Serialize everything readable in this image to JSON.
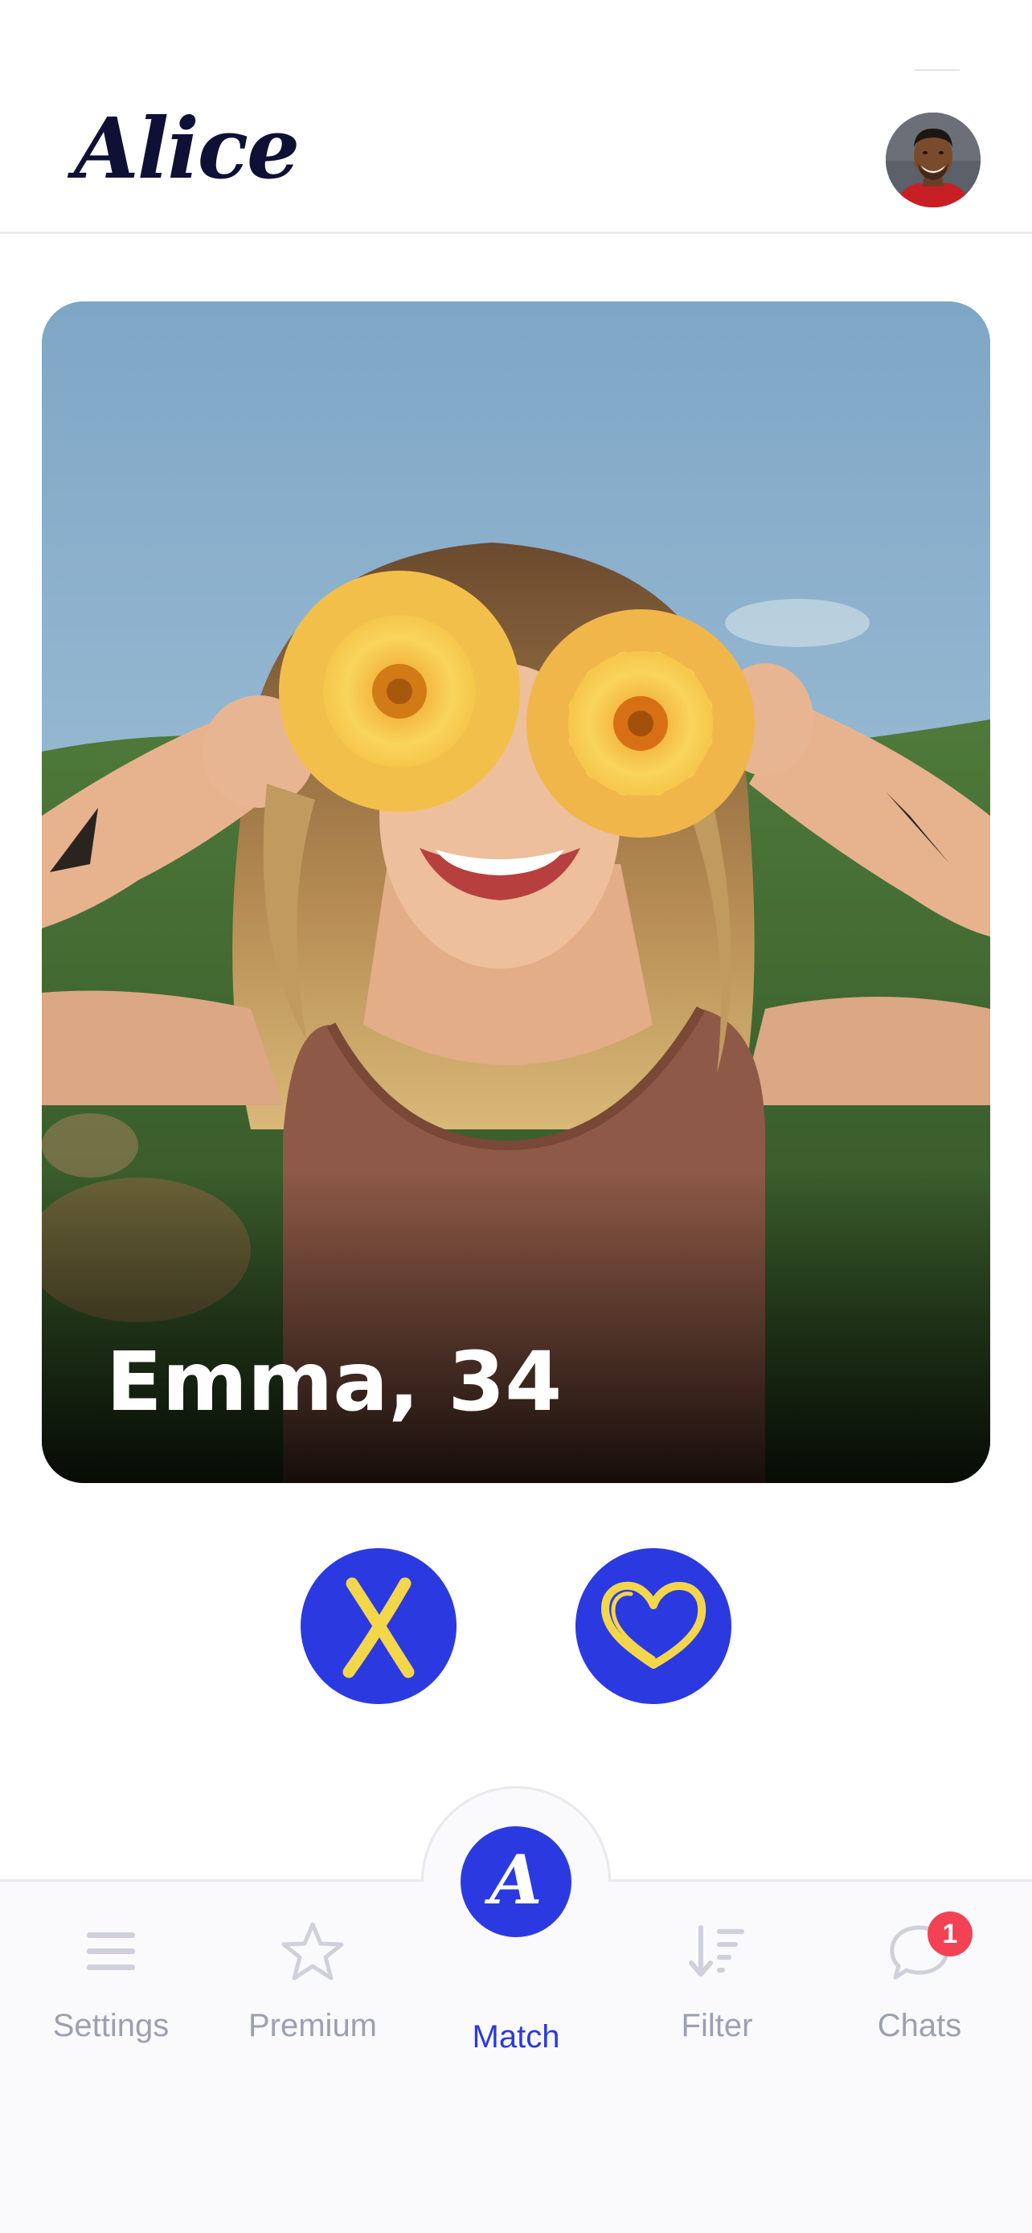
{
  "app": {
    "logo_text": "Alice"
  },
  "header": {
    "avatar_icon": "user-avatar-photo"
  },
  "profile_card": {
    "name_age": "Emma, 34",
    "photo_description_icon": "profile-photo"
  },
  "actions": {
    "dislike_icon": "x-icon",
    "like_icon": "heart-icon"
  },
  "bottom_nav": {
    "items": [
      {
        "label": "Settings",
        "icon": "hamburger-icon",
        "active": false
      },
      {
        "label": "Premium",
        "icon": "star-icon",
        "active": false
      },
      {
        "label": "Match",
        "icon": "alice-logo-icon",
        "active": true
      },
      {
        "label": "Filter",
        "icon": "sort-filter-icon",
        "active": false
      },
      {
        "label": "Chats",
        "icon": "chat-bubble-icon",
        "active": false
      }
    ],
    "match_letter": "A",
    "chats_badge_count": "1"
  },
  "colors": {
    "accent": "#2b3ae0",
    "accent_icon": "#f4d64a",
    "badge": "#f24254",
    "inactive": "#9d9fb2",
    "logo": "#0f1036"
  }
}
